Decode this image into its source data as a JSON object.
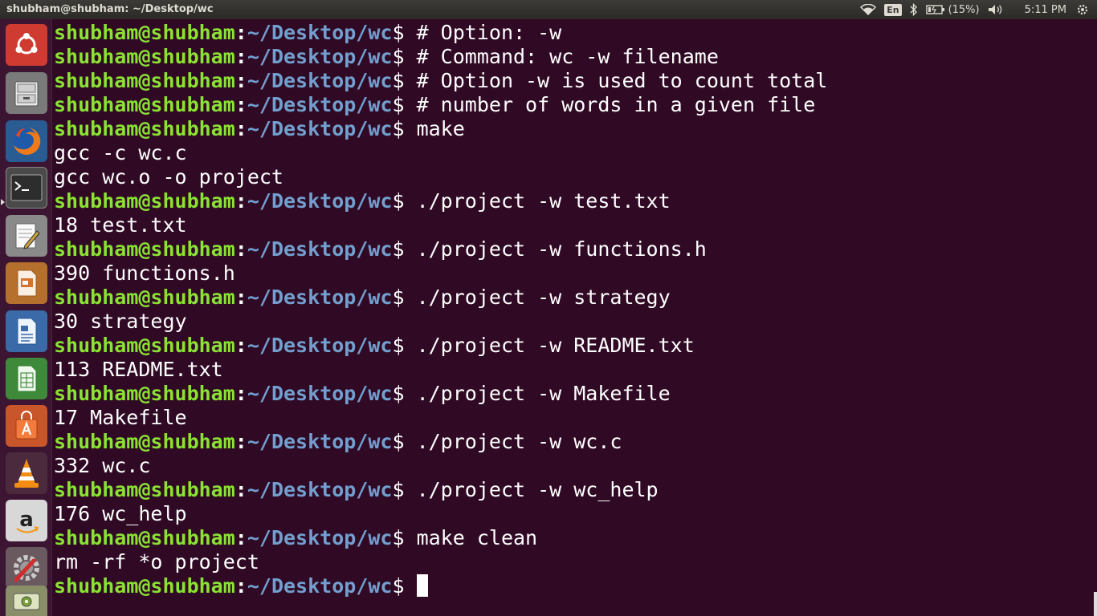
{
  "window": {
    "title": "shubham@shubham: ~/Desktop/wc"
  },
  "indicators": {
    "keyboard": "En",
    "battery": "(15%)",
    "time": "5:11 PM"
  },
  "launcher": {
    "items": [
      {
        "name": "dash-home",
        "icon": "ubuntu-logo"
      },
      {
        "name": "files",
        "icon": "file-cabinet"
      },
      {
        "name": "firefox",
        "icon": "firefox"
      },
      {
        "name": "terminal",
        "icon": "terminal"
      },
      {
        "name": "text-editor",
        "icon": "notepad-pencil"
      },
      {
        "name": "libreoffice-impress",
        "icon": "presentation"
      },
      {
        "name": "libreoffice-writer",
        "icon": "document"
      },
      {
        "name": "libreoffice-calc",
        "icon": "spreadsheet"
      },
      {
        "name": "software-center",
        "icon": "shopping-bag"
      },
      {
        "name": "vlc",
        "icon": "traffic-cone"
      },
      {
        "name": "amazon",
        "icon": "amazon"
      },
      {
        "name": "system-settings",
        "icon": "gear-wrench"
      },
      {
        "name": "disks",
        "icon": "disk-drive"
      }
    ]
  },
  "terminal": {
    "prompt": {
      "user": "shubham@shubham",
      "colon": ":",
      "path": "~/Desktop/wc",
      "dollar": "$"
    },
    "lines": [
      {
        "type": "prompt",
        "text": " # Option: -w"
      },
      {
        "type": "prompt",
        "text": " # Command: wc -w filename"
      },
      {
        "type": "prompt",
        "text": " # Option -w is used to count total"
      },
      {
        "type": "prompt",
        "text": " # number of words in a given file"
      },
      {
        "type": "prompt",
        "text": " make"
      },
      {
        "type": "output",
        "text": "gcc -c wc.c"
      },
      {
        "type": "output",
        "text": "gcc wc.o -o project"
      },
      {
        "type": "prompt",
        "text": " ./project -w test.txt"
      },
      {
        "type": "output",
        "text": "18 test.txt"
      },
      {
        "type": "prompt",
        "text": " ./project -w functions.h"
      },
      {
        "type": "output",
        "text": "390 functions.h"
      },
      {
        "type": "prompt",
        "text": " ./project -w strategy"
      },
      {
        "type": "output",
        "text": "30 strategy"
      },
      {
        "type": "prompt",
        "text": " ./project -w README.txt"
      },
      {
        "type": "output",
        "text": "113 README.txt"
      },
      {
        "type": "prompt",
        "text": " ./project -w Makefile"
      },
      {
        "type": "output",
        "text": "17 Makefile"
      },
      {
        "type": "prompt",
        "text": " ./project -w wc.c"
      },
      {
        "type": "output",
        "text": "332 wc.c"
      },
      {
        "type": "prompt",
        "text": " ./project -w wc_help"
      },
      {
        "type": "output",
        "text": "176 wc_help"
      },
      {
        "type": "prompt",
        "text": " make clean"
      },
      {
        "type": "output",
        "text": "rm -rf *o project"
      },
      {
        "type": "prompt",
        "text": " ",
        "cursor": true
      }
    ]
  }
}
